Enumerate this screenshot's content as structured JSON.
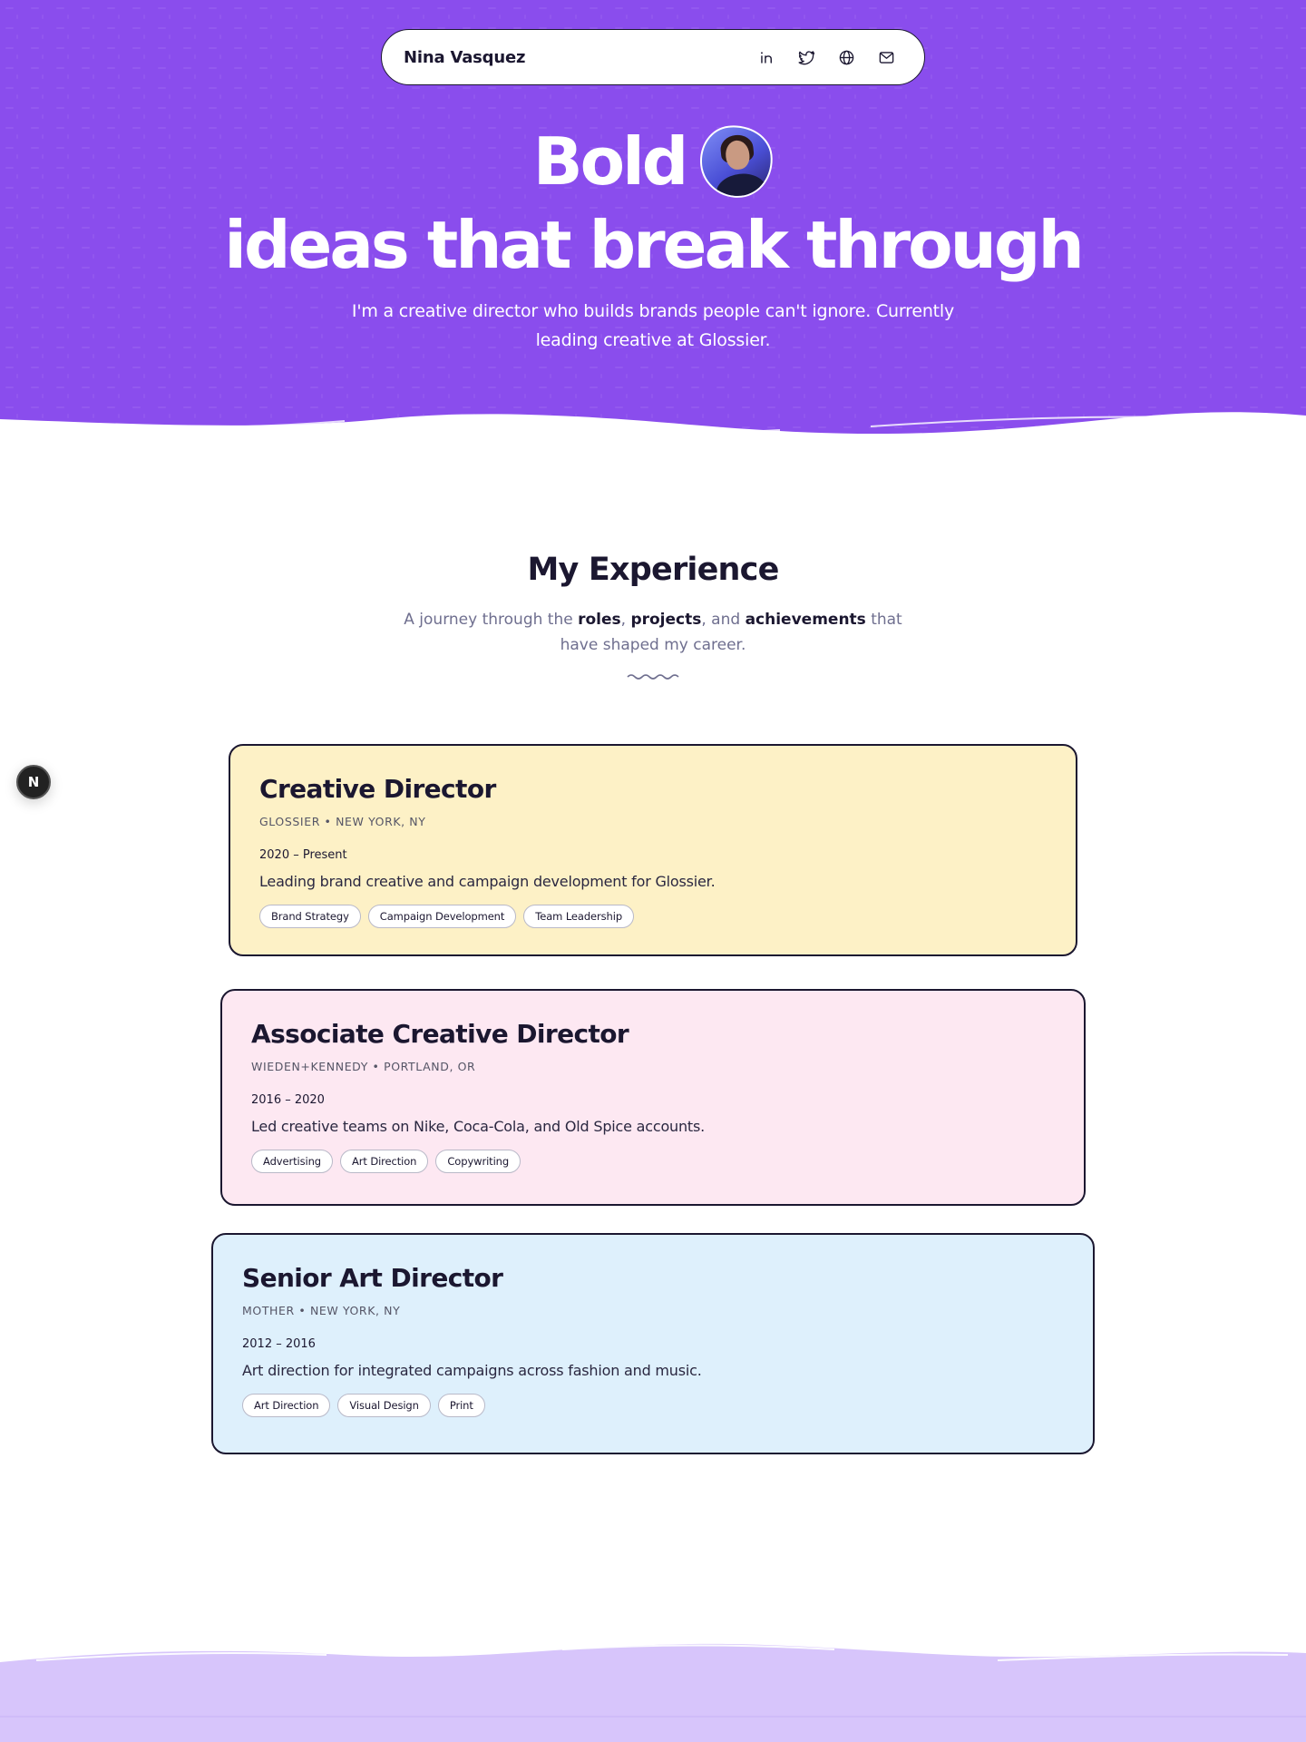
{
  "colors": {
    "hero_purple": "#8a4ded",
    "footer_lavender": "#d7c5fb",
    "card_yellow": "#fdf1c6",
    "card_pink": "#fde8f2",
    "card_blue": "#def0fc",
    "ink": "#1b1730"
  },
  "nav": {
    "brand": "Nina Vasquez",
    "icons": [
      "linkedin-icon",
      "twitter-icon",
      "globe-icon",
      "mail-icon"
    ]
  },
  "hero": {
    "headline_word": "Bold",
    "headline_rest": "ideas that break through",
    "subtitle": "I'm a creative director who builds brands people can't ignore. Currently leading creative at Glossier."
  },
  "experience": {
    "title": "My Experience",
    "sub_prefix": "A journey through the ",
    "sub_roles": "roles",
    "sub_comma": ", ",
    "sub_projects": "projects",
    "sub_and": ", and ",
    "sub_achievements": "achievements",
    "sub_suffix": " that have shaped my career.",
    "jobs": [
      {
        "role": "Creative Director",
        "company": "GLOSSIER • NEW YORK, NY",
        "period": "2020 – Present",
        "description": "Leading brand creative and campaign development for Glossier.",
        "tags": [
          "Brand Strategy",
          "Campaign Development",
          "Team Leadership"
        ]
      },
      {
        "role": "Associate Creative Director",
        "company": "WIEDEN+KENNEDY • PORTLAND, OR",
        "period": "2016 – 2020",
        "description": "Led creative teams on Nike, Coca-Cola, and Old Spice accounts.",
        "tags": [
          "Advertising",
          "Art Direction",
          "Copywriting"
        ]
      },
      {
        "role": "Senior Art Director",
        "company": "MOTHER • NEW YORK, NY",
        "period": "2012 – 2016",
        "description": "Art direction for integrated campaigns across fashion and music.",
        "tags": [
          "Art Direction",
          "Visual Design",
          "Print"
        ]
      }
    ]
  },
  "badge": {
    "letter": "N"
  }
}
